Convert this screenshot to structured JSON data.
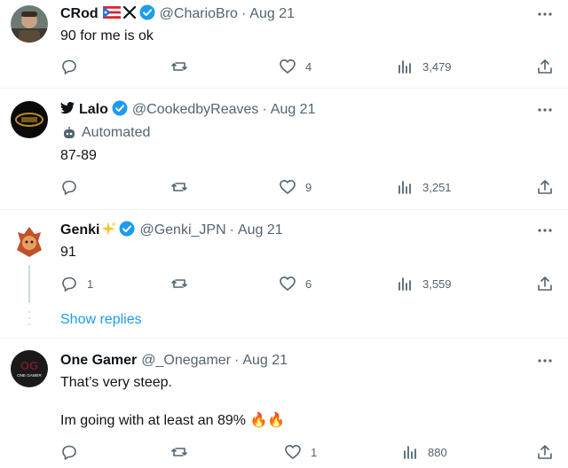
{
  "tweets": [
    {
      "name": "CRod",
      "handle": "@CharioBro",
      "date": "Aug 21",
      "text": "90 for me is ok",
      "replies": "",
      "likes": "4",
      "views": "3,479"
    },
    {
      "name": "Lalo",
      "handle": "@CookedbyReaves",
      "date": "Aug 21",
      "automated_label": "Automated",
      "text": "87-89",
      "replies": "",
      "likes": "9",
      "views": "3,251"
    },
    {
      "name": "Genki",
      "handle": "@Genki_JPN",
      "date": "Aug 21",
      "text": "91",
      "replies": "1",
      "likes": "6",
      "views": "3,559"
    },
    {
      "name": "One Gamer",
      "handle": "@_Onegamer",
      "date": "Aug 21",
      "text_line1": "That’s very steep.",
      "text_line2": "Im going with at least an 89% 🔥🔥",
      "likes": "1",
      "views": "880"
    }
  ],
  "show_replies_label": "Show replies",
  "separator": "·",
  "colors": {
    "accent": "#1d9bf0",
    "secondary_text": "#536471",
    "divider": "#eff3f4"
  },
  "avatar_text_4": "ONE GAMER"
}
